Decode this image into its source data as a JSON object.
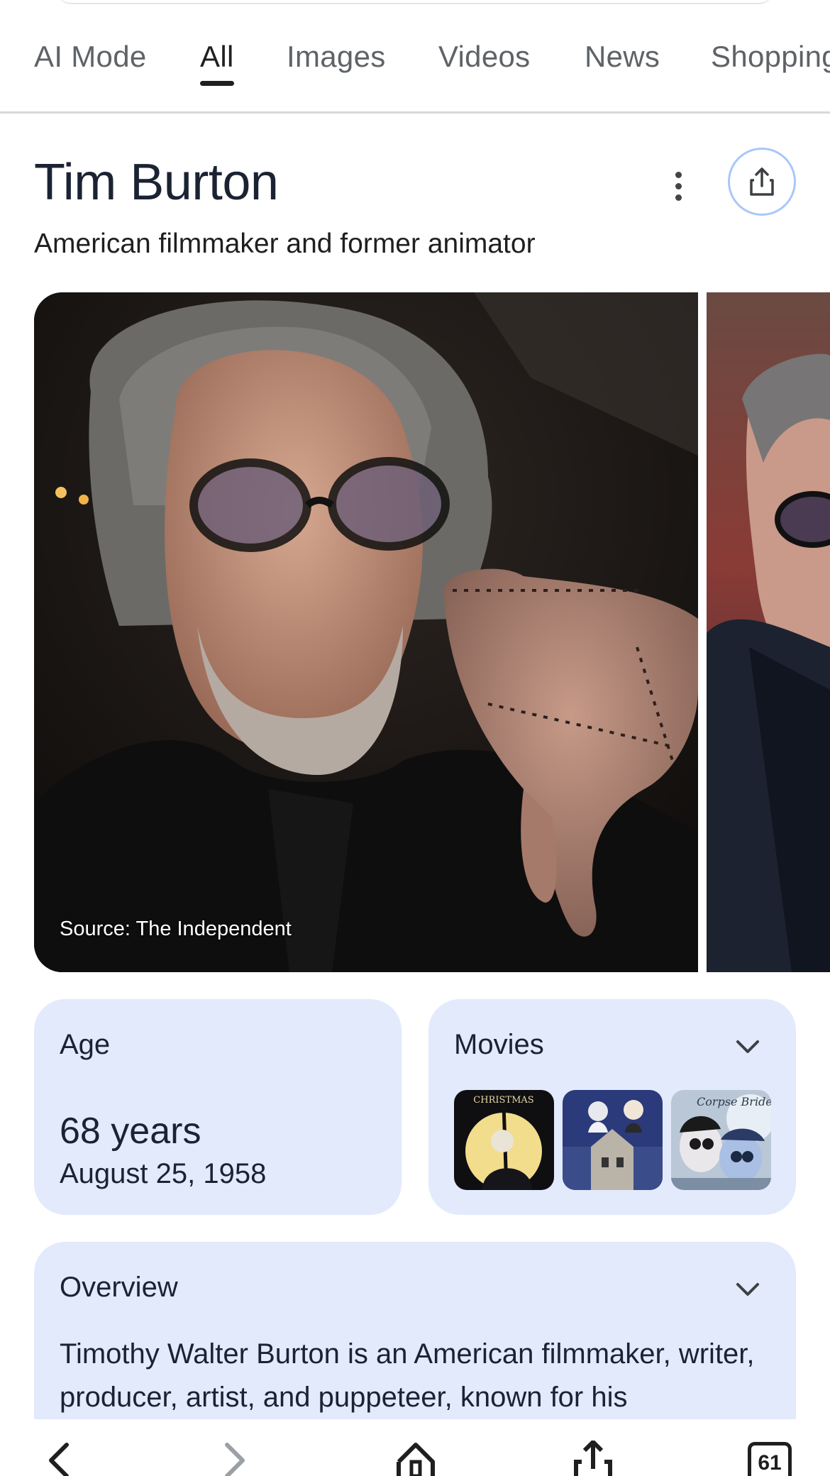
{
  "tabs": [
    {
      "label": "AI Mode",
      "active": false
    },
    {
      "label": "All",
      "active": true
    },
    {
      "label": "Images",
      "active": false
    },
    {
      "label": "Videos",
      "active": false
    },
    {
      "label": "News",
      "active": false
    },
    {
      "label": "Shopping",
      "active": false
    }
  ],
  "knowledge_panel": {
    "title": "Tim Burton",
    "subtitle": "American filmmaker and former animator",
    "photo_caption": "Source: The Independent"
  },
  "age_card": {
    "label": "Age",
    "value": "68 years",
    "date": "August 25, 1958"
  },
  "movies_card": {
    "label": "Movies",
    "thumbnail_lettering": [
      "CHRISTMAS",
      "",
      "Corpse Bride"
    ]
  },
  "overview_card": {
    "label": "Overview",
    "text": "Timothy Walter Burton is an American filmmaker, writer, producer, artist, and puppeteer, known for his"
  },
  "bottom_nav": {
    "tab_count": "61"
  },
  "colors": {
    "card_background": "#e2eafc",
    "share_ring": "#a8c7fa",
    "title_text": "#1b2333"
  }
}
